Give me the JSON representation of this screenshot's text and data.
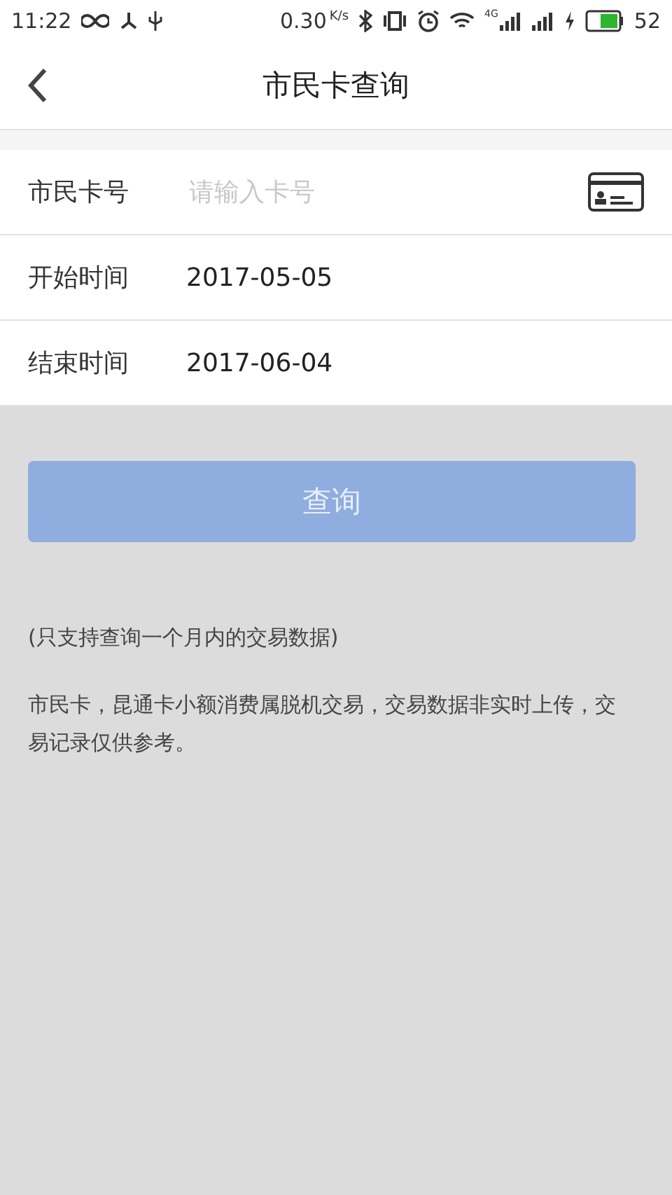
{
  "status_bar": {
    "time": "11:22",
    "speed": "0.30",
    "speed_unit": "K/s",
    "signal_label": "4G",
    "battery": "52"
  },
  "header": {
    "title": "市民卡查询"
  },
  "form": [
    {
      "kind": "input",
      "label": "市民卡号",
      "placeholder": "请输入卡号"
    },
    {
      "kind": "value",
      "label": "开始时间",
      "value": "2017-05-05"
    },
    {
      "kind": "value",
      "label": "结束时间",
      "value": "2017-06-04"
    }
  ],
  "query_button": {
    "label": "查询",
    "disabled": true
  },
  "notes": [
    "(只支持查询一个月内的交易数据)",
    "市民卡，昆通卡小额消费属脱机交易，交易数据非实时上传，交易记录仅供参考。"
  ]
}
